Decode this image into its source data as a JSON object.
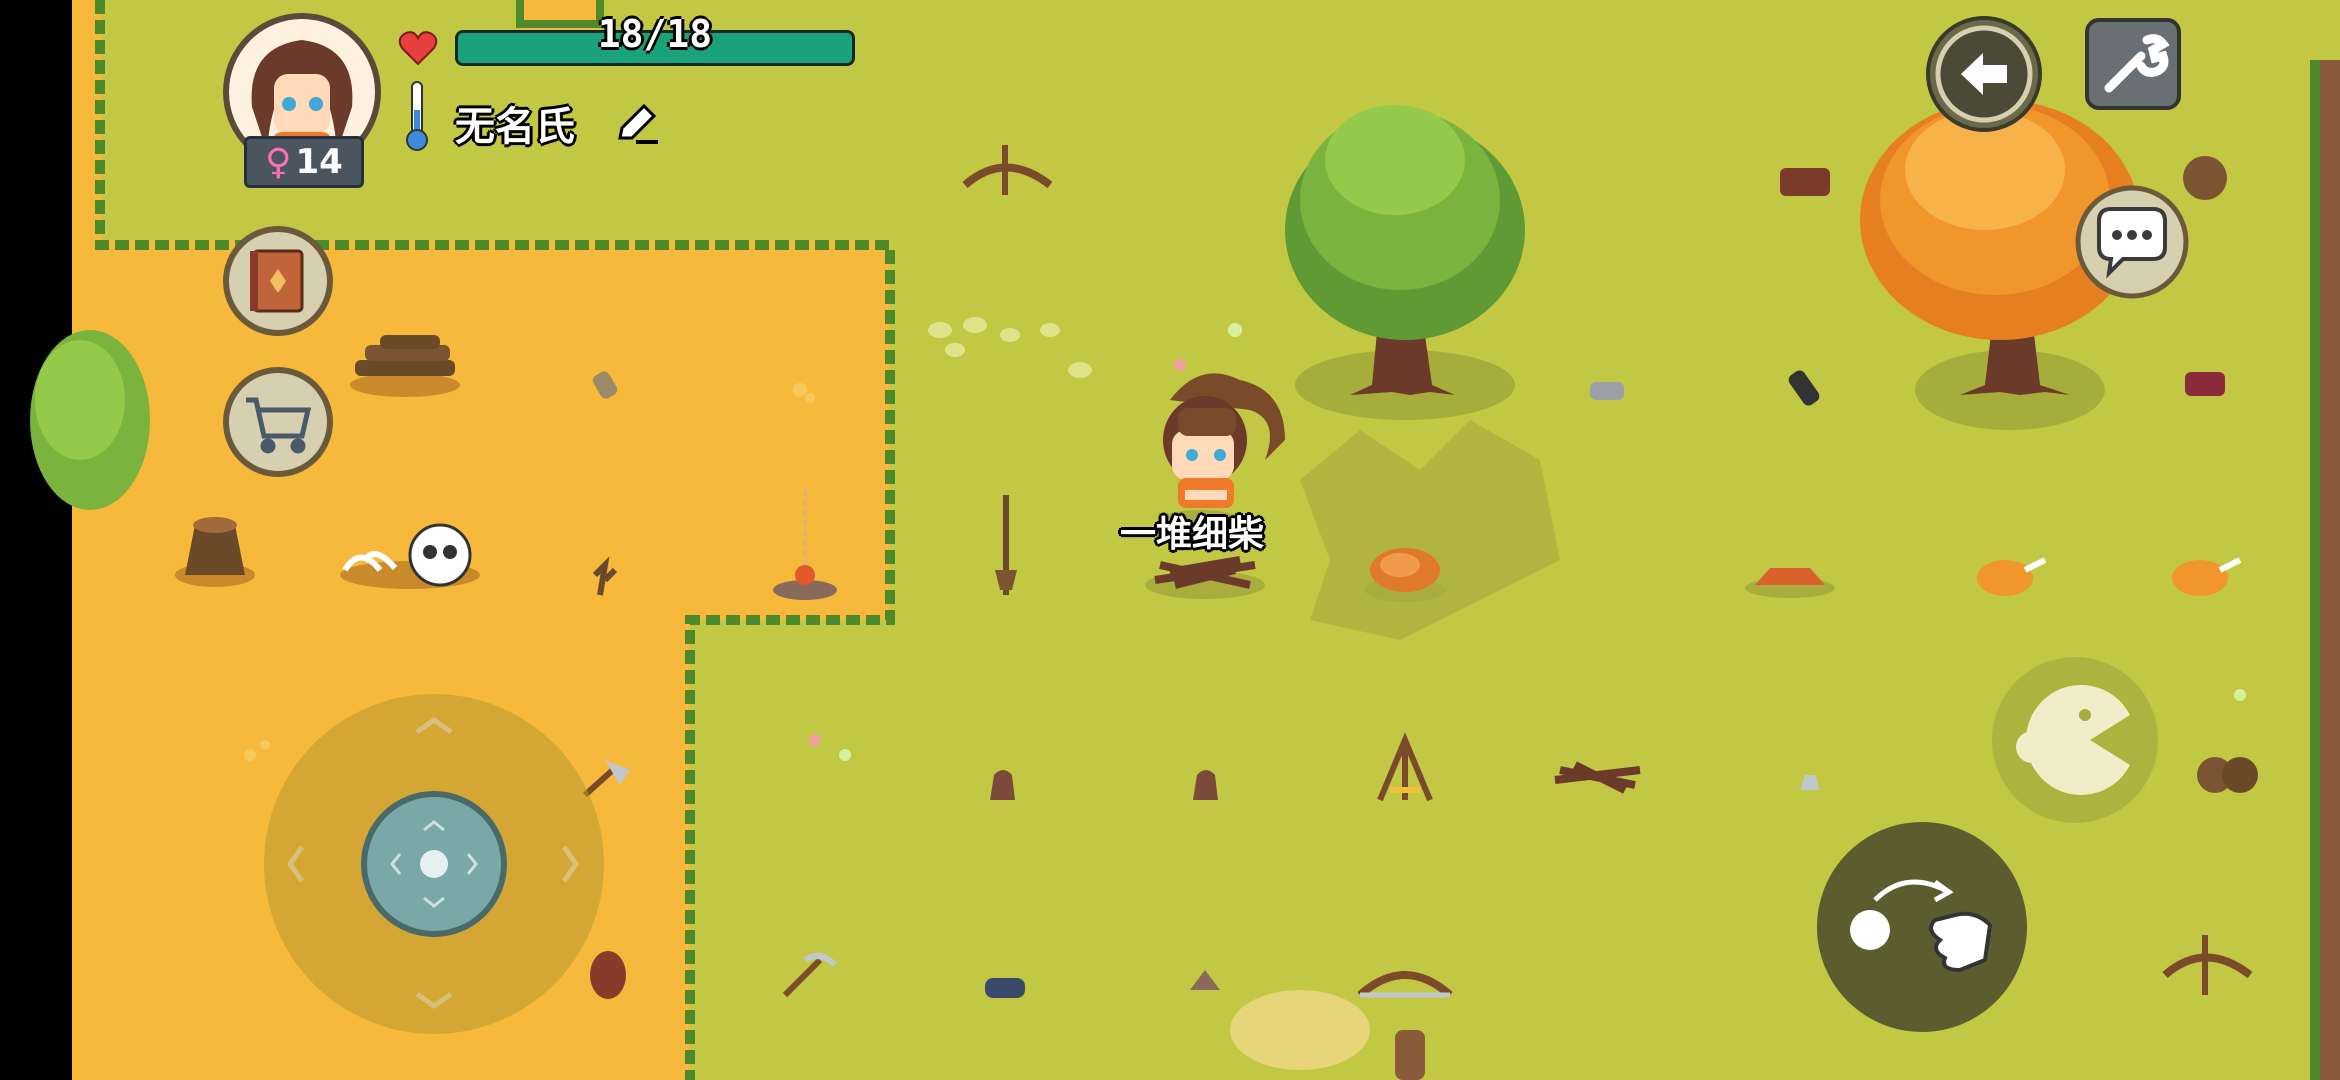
{
  "hud": {
    "hp": {
      "current": 18,
      "max": 18,
      "text": "18/18",
      "fill_fraction": 1.0
    },
    "player_name": "无名氏",
    "level": "14",
    "gender_symbol": "♀"
  },
  "world": {
    "hover_item_label": "一堆细柴"
  },
  "controls": {
    "back_icon": "back-arrow-icon",
    "settings_icon": "wrench-icon",
    "chat_icon": "chat-bubble-icon",
    "journal_icon": "book-icon",
    "shop_icon": "shopping-cart-icon",
    "eat_icon": "pacman-eat-icon",
    "throw_icon": "throw-hand-icon",
    "joystick": "virtual-joystick"
  },
  "colors": {
    "grass": "#c2c844",
    "sand": "#f6b93b",
    "hp_fill": "#1aa37a",
    "heart": "#e8403f",
    "tree_green": "#7bb33f",
    "tree_orange": "#f0962b"
  }
}
